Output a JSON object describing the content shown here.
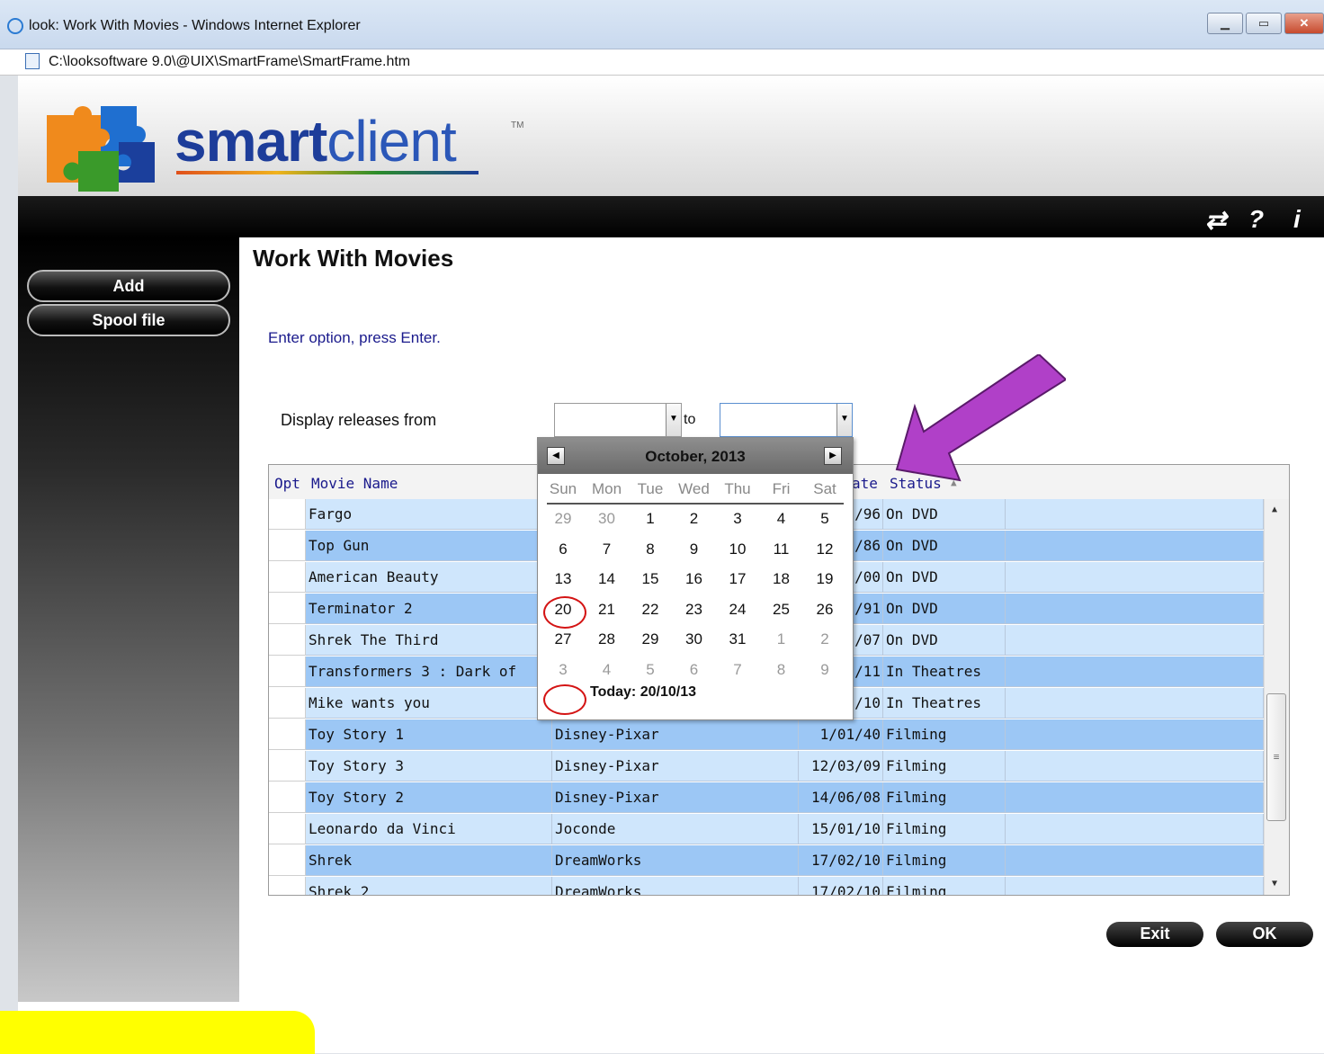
{
  "window": {
    "title": "look: Work With Movies - Windows Internet Explorer",
    "address": "C:\\looksoftware 9.0\\@UIX\\SmartFrame\\SmartFrame.htm",
    "controls": [
      "minimize-icon",
      "maximize-icon",
      "close-icon"
    ]
  },
  "brand": {
    "logo_bold": "smart",
    "logo_light": "client",
    "tm": "TM"
  },
  "toolbar_icons": [
    "refresh-icon",
    "help-icon",
    "info-icon"
  ],
  "sidebar": {
    "items": [
      {
        "label": "Add"
      },
      {
        "label": "Spool file"
      }
    ]
  },
  "page": {
    "title": "Work With Movies",
    "prompt": "Enter option, press Enter.",
    "range_label": "Display releases from",
    "to_label": "to",
    "from_value": "",
    "to_value": ""
  },
  "grid": {
    "columns": [
      "Opt",
      "Movie Name",
      "ate",
      "Status"
    ],
    "rows": [
      {
        "name": "Fargo",
        "studio": "",
        "date": "/96",
        "status": "On DVD"
      },
      {
        "name": "Top Gun",
        "studio": "",
        "date": "/86",
        "status": "On DVD"
      },
      {
        "name": "American Beauty",
        "studio": "",
        "date": "/00",
        "status": "On DVD"
      },
      {
        "name": "Terminator 2",
        "studio": "",
        "date": "/91",
        "status": "On DVD"
      },
      {
        "name": "Shrek The Third",
        "studio": "",
        "date": "/07",
        "status": "On DVD"
      },
      {
        "name": "Transformers 3 : Dark of",
        "studio": "",
        "date": "/11",
        "status": "In Theatres"
      },
      {
        "name": "Mike wants you",
        "studio": "",
        "date": "/10",
        "status": "In Theatres"
      },
      {
        "name": "Toy Story 1",
        "studio": "Disney-Pixar",
        "date": "1/01/40",
        "status": "Filming"
      },
      {
        "name": "Toy Story 3",
        "studio": "Disney-Pixar",
        "date": "12/03/09",
        "status": "Filming"
      },
      {
        "name": "Toy Story 2",
        "studio": "Disney-Pixar",
        "date": "14/06/08",
        "status": "Filming"
      },
      {
        "name": "Leonardo da Vinci",
        "studio": "Joconde",
        "date": "15/01/10",
        "status": "Filming"
      },
      {
        "name": "Shrek",
        "studio": "DreamWorks",
        "date": "17/02/10",
        "status": "Filming"
      },
      {
        "name": "Shrek 2",
        "studio": "DreamWorks",
        "date": "17/02/10",
        "status": "Filming"
      }
    ]
  },
  "calendar": {
    "title": "October, 2013",
    "days": [
      "Sun",
      "Mon",
      "Tue",
      "Wed",
      "Thu",
      "Fri",
      "Sat"
    ],
    "weeks": [
      [
        [
          "29",
          0
        ],
        [
          "30",
          0
        ],
        [
          "1",
          1
        ],
        [
          "2",
          1
        ],
        [
          "3",
          1
        ],
        [
          "4",
          1
        ],
        [
          "5",
          1
        ]
      ],
      [
        [
          "6",
          1
        ],
        [
          "7",
          1
        ],
        [
          "8",
          1
        ],
        [
          "9",
          1
        ],
        [
          "10",
          1
        ],
        [
          "11",
          1
        ],
        [
          "12",
          1
        ]
      ],
      [
        [
          "13",
          1
        ],
        [
          "14",
          1
        ],
        [
          "15",
          1
        ],
        [
          "16",
          1
        ],
        [
          "17",
          1
        ],
        [
          "18",
          1
        ],
        [
          "19",
          1
        ]
      ],
      [
        [
          "20",
          1
        ],
        [
          "21",
          1
        ],
        [
          "22",
          1
        ],
        [
          "23",
          1
        ],
        [
          "24",
          1
        ],
        [
          "25",
          1
        ],
        [
          "26",
          1
        ]
      ],
      [
        [
          "27",
          1
        ],
        [
          "28",
          1
        ],
        [
          "29",
          1
        ],
        [
          "30",
          1
        ],
        [
          "31",
          1
        ],
        [
          "1",
          0
        ],
        [
          "2",
          0
        ]
      ],
      [
        [
          "3",
          0
        ],
        [
          "4",
          0
        ],
        [
          "5",
          0
        ],
        [
          "6",
          0
        ],
        [
          "7",
          0
        ],
        [
          "8",
          0
        ],
        [
          "9",
          0
        ]
      ]
    ],
    "today_text": "Today: 20/10/13",
    "selected_day": "20"
  },
  "actions": {
    "exit": "Exit",
    "ok": "OK"
  },
  "colors": {
    "row_light": "#cfe6fc",
    "row_dark": "#9cc7f5",
    "annotation_arrow": "#b040c8",
    "highlight": "#ffff00",
    "circle": "#d41414"
  }
}
